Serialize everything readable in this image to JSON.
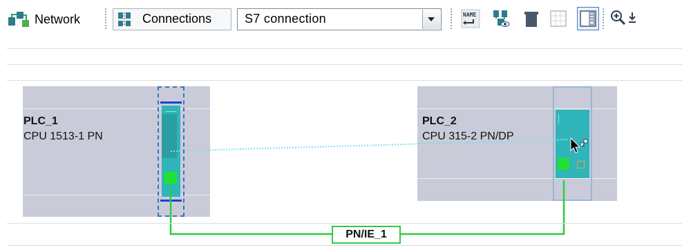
{
  "toolbar": {
    "network_label": "Network",
    "connections_label": "Connections",
    "connection_type": "S7 connection"
  },
  "devices": [
    {
      "name": "PLC_1",
      "type": "CPU 1513-1 PN"
    },
    {
      "name": "PLC_2",
      "type": "CPU 315-2 PN/DP"
    }
  ],
  "subnet": {
    "label": "PN/IE_1"
  },
  "colors": {
    "subnet_line": "#2ecc40",
    "connection_line": "#6fd8f0",
    "cpu_module": "#2fb5b9",
    "plc_box": "#c9ccd8",
    "selection_border": "#3a6fc4"
  }
}
